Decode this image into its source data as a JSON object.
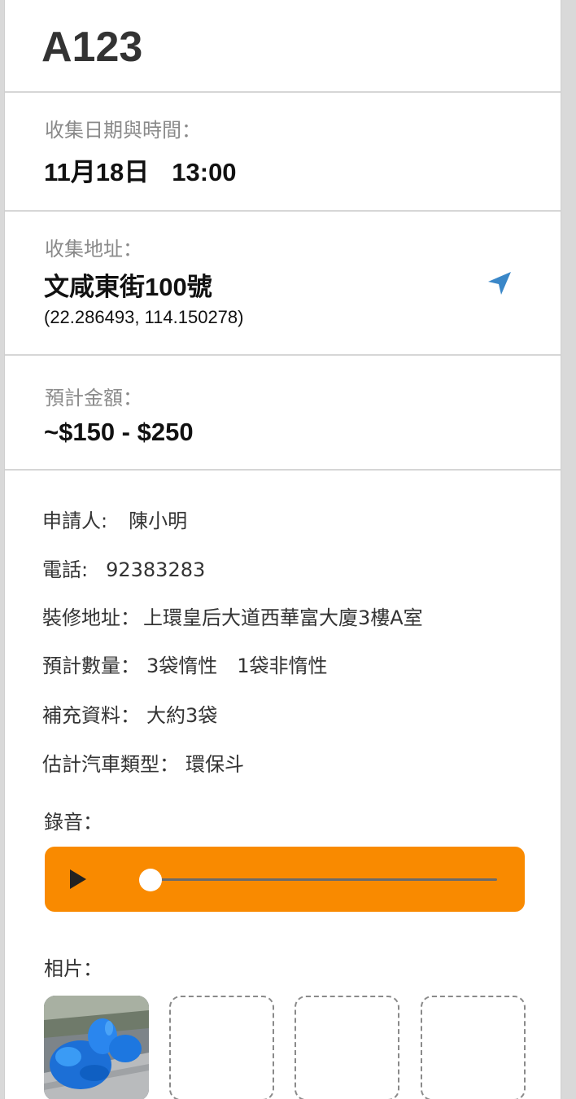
{
  "order": {
    "id": "A123"
  },
  "collection_datetime": {
    "label": "收集日期與時間：",
    "date": "11月18日",
    "time": "13:00"
  },
  "collection_address": {
    "label": "收集地址：",
    "address": "文咸東街100號",
    "coordinates": "(22.286493, 114.150278)",
    "nav_icon": "navigation-arrow-icon",
    "nav_icon_color": "#3a87c8"
  },
  "estimated_amount": {
    "label": "預計金額：",
    "value": "~$150 - $250"
  },
  "details": {
    "applicant_label": "申請人:",
    "applicant_value": "陳小明",
    "phone_label": "電話:",
    "phone_value": "92383283",
    "renovation_address_label": "裝修地址：",
    "renovation_address_value": "上環皇后大道西華富大廈3樓A室",
    "estimated_quantity_label": "預計數量：",
    "estimated_quantity_value": "3袋惰性　1袋非惰性",
    "extra_info_label": "補充資料：",
    "extra_info_value": "大約3袋",
    "vehicle_type_label": "估計汽車類型：",
    "vehicle_type_value": "環保斗"
  },
  "recording": {
    "label": "錄音：",
    "player_color": "#f98a00",
    "play_icon": "play-icon",
    "progress": 0.0
  },
  "photos": {
    "label": "相片：",
    "slots": [
      {
        "filled": true,
        "description_icon": "photo-thumbnail"
      },
      {
        "filled": false
      },
      {
        "filled": false
      },
      {
        "filled": false
      }
    ]
  }
}
